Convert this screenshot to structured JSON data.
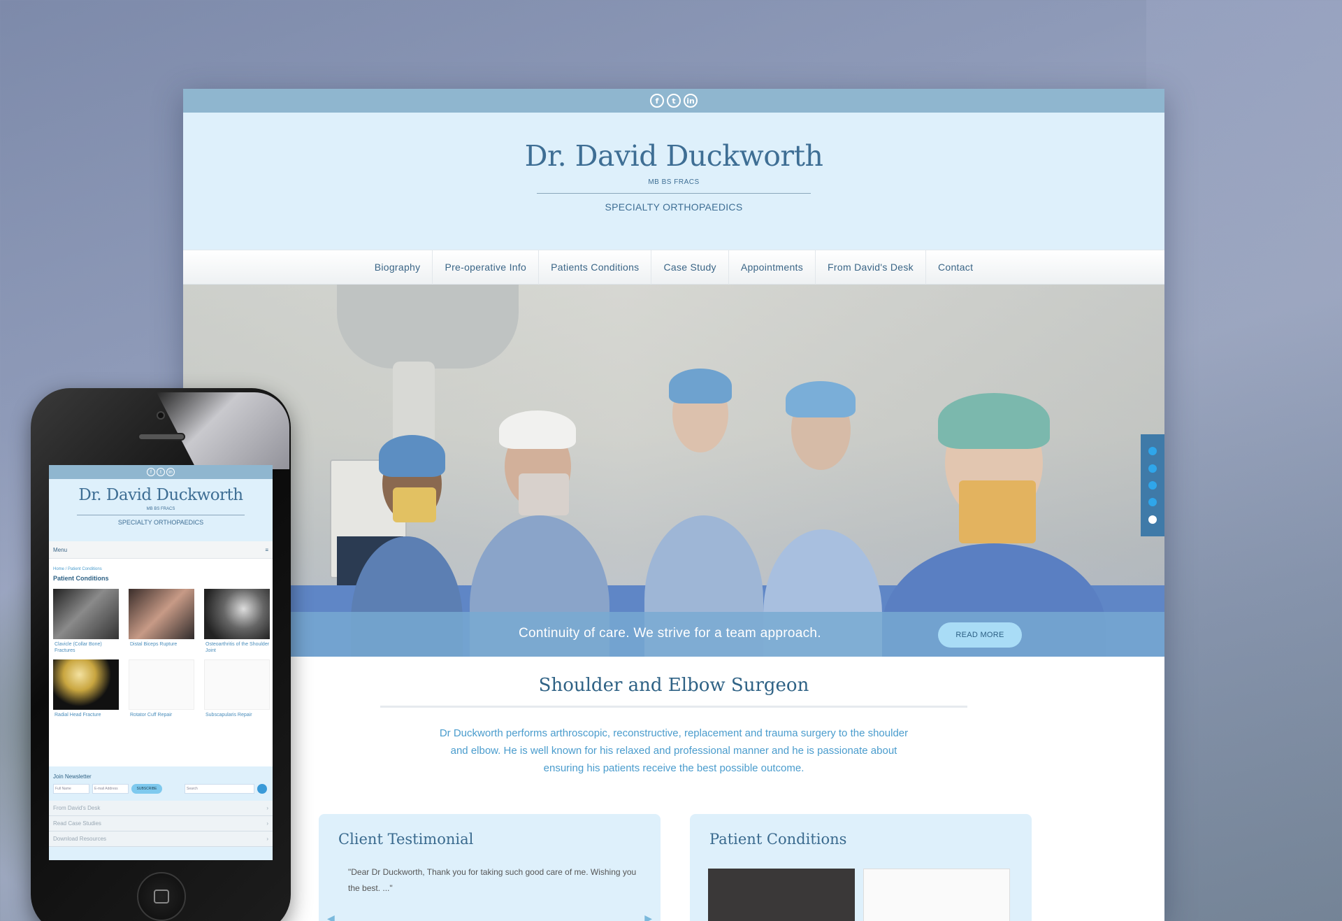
{
  "site": {
    "social": [
      "f",
      "t",
      "in"
    ],
    "name": "Dr. David Duckworth",
    "credentials": "MB BS FRACS",
    "tagline": "SPECIALTY ORTHOPAEDICS",
    "nav": [
      "Biography",
      "Pre-operative Info",
      "Patients Conditions",
      "Case Study",
      "Appointments",
      "From David's Desk",
      "Contact"
    ],
    "hero": {
      "caption": "Continuity of care. We strive for a team approach.",
      "button": "READ MORE",
      "slides": 5,
      "active_slide": 5
    },
    "intro": {
      "heading": "Shoulder and Elbow Surgeon",
      "body": "Dr Duckworth performs arthroscopic, reconstructive, replacement and trauma surgery to the shoulder and elbow. He is well known for his relaxed and professional manner and he is passionate about ensuring his patients receive the best possible outcome."
    },
    "testimonial": {
      "title": "Client Testimonial",
      "quote": "\"Dear Dr Duckworth, Thank you for taking such good care of me. Wishing you the best. ...\""
    },
    "conditions_card": {
      "title": "Patient Conditions"
    }
  },
  "mobile": {
    "social": [
      "f",
      "t",
      "in"
    ],
    "name": "Dr. David Duckworth",
    "credentials": "MB BS FRACS",
    "tagline": "SPECIALTY ORTHOPAEDICS",
    "menu_label": "Menu",
    "menu_icon": "≡",
    "breadcrumb": "Home / Patient Conditions",
    "page_title": "Patient Conditions",
    "conditions": [
      "Clavicle (Collar Bone) Fractures",
      "Distal Biceps Rupture",
      "Osteoarthritis of the Shoulder Joint",
      "Radial Head Fracture",
      "Rotator Cuff Repair",
      "Subscapularis Repair"
    ],
    "newsletter": {
      "title": "Join Newsletter",
      "name_placeholder": "Full Name",
      "email_placeholder": "E-mail Address",
      "subscribe": "SUBSCRIBE",
      "search_placeholder": "Search"
    },
    "links": [
      "From David's Desk",
      "Read Case Studies",
      "Download Resources"
    ]
  },
  "colors": {
    "header_bg": "#def0fb",
    "topbar": "#8fb6cf",
    "brand": "#3e6e94",
    "accent": "#4a9ccd"
  }
}
